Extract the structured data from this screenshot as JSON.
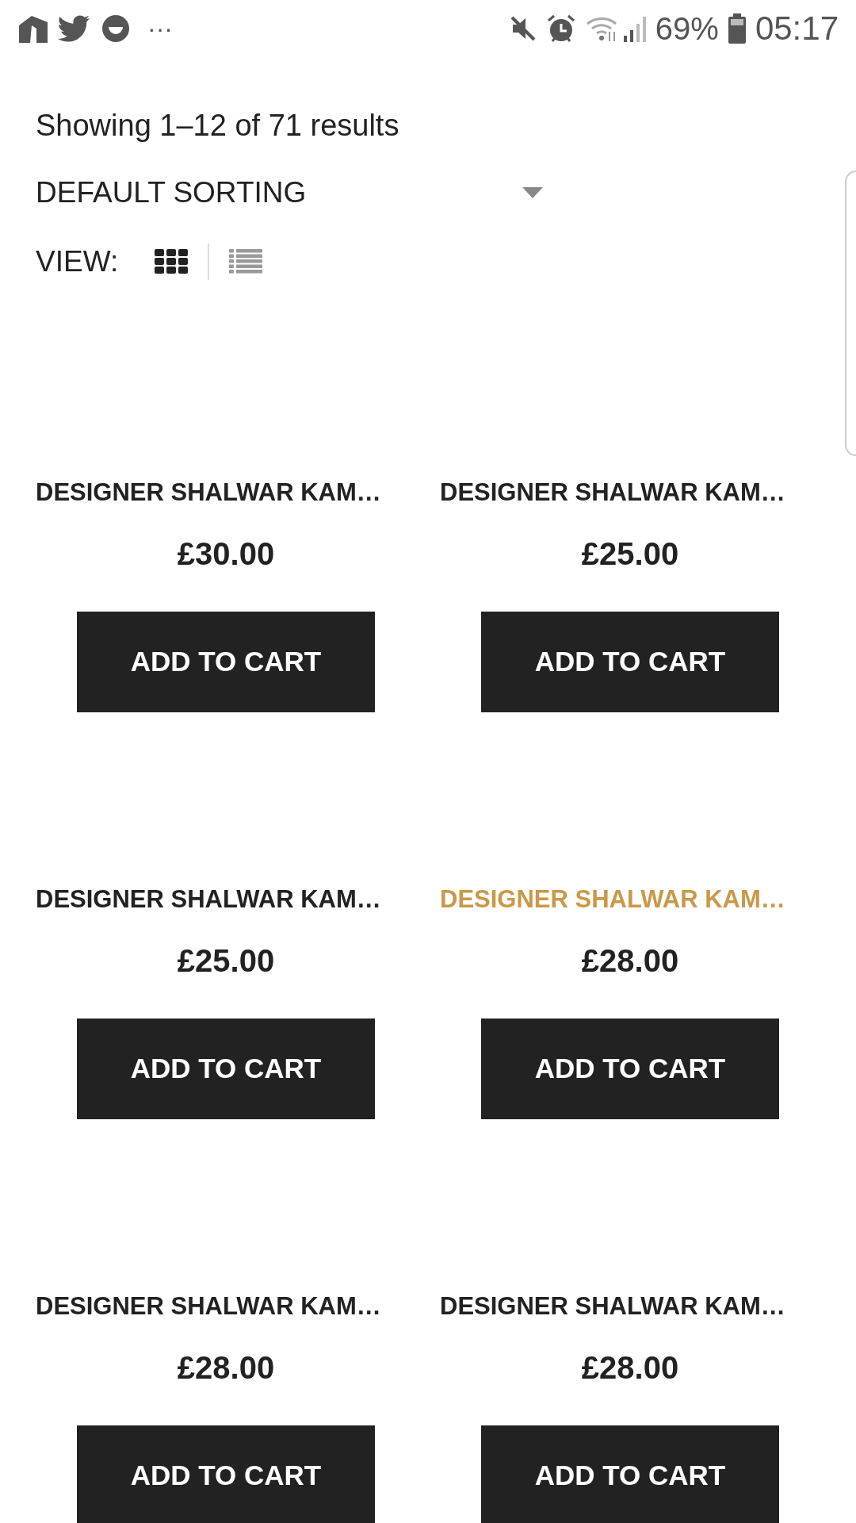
{
  "status_bar": {
    "more": "···",
    "battery": "69%",
    "time": "05:17"
  },
  "result_count": "Showing 1–12 of 71 results",
  "sorting": {
    "label": "DEFAULT SORTING"
  },
  "view": {
    "label": "VIEW:",
    "modes": [
      {
        "kind": "grid",
        "selected": true
      },
      {
        "kind": "list",
        "selected": false
      }
    ]
  },
  "products": [
    {
      "title": "DESIGNER SHALWAR KAM…",
      "price": "£30.00",
      "button": "ADD TO CART",
      "hovered": false
    },
    {
      "title": "DESIGNER SHALWAR KAM…",
      "price": "£25.00",
      "button": "ADD TO CART",
      "hovered": false
    },
    {
      "title": "DESIGNER SHALWAR KAM…",
      "price": "£25.00",
      "button": "ADD TO CART",
      "hovered": false
    },
    {
      "title": "DESIGNER SHALWAR KAM…",
      "price": "£28.00",
      "button": "ADD TO CART",
      "hovered": true
    },
    {
      "title": "DESIGNER SHALWAR KAM…",
      "price": "£28.00",
      "button": "ADD TO CART",
      "hovered": false
    },
    {
      "title": "DESIGNER SHALWAR KAM…",
      "price": "£28.00",
      "button": "ADD TO CART",
      "hovered": false
    }
  ]
}
